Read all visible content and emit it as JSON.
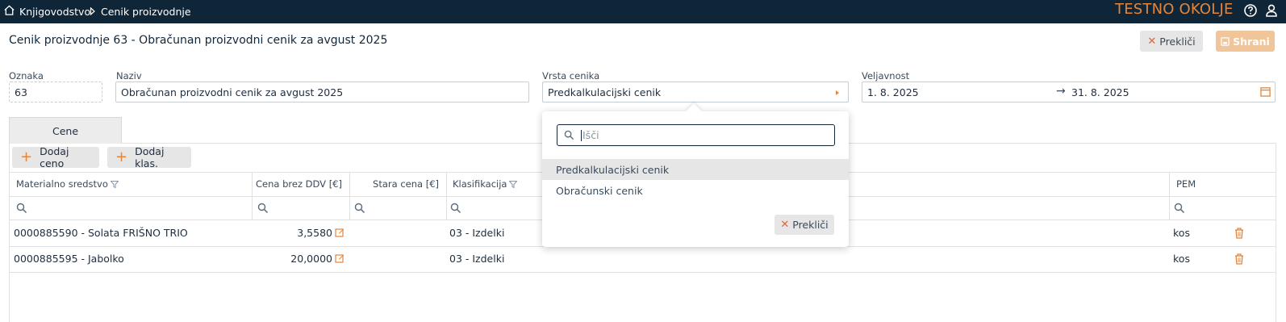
{
  "topbar": {
    "breadcrumb": [
      "Knjigovodstvo",
      "Cenik proizvodnje"
    ],
    "environment": "TESTNO OKOLJE"
  },
  "page": {
    "title": "Cenik proizvodnje 63 - Obračunan proizvodni cenik za avgust 2025",
    "cancel_label": "Prekliči",
    "save_label": "Shrani"
  },
  "form": {
    "oznaka_label": "Oznaka",
    "oznaka_value": "63",
    "naziv_label": "Naziv",
    "naziv_value": "Obračunan proizvodni cenik za avgust 2025",
    "vrsta_label": "Vrsta cenika",
    "vrsta_value": "Predkalkulacijski cenik",
    "veljavnost_label": "Veljavnost",
    "veljavnost_from": "1. 8. 2025",
    "veljavnost_to": "31. 8. 2025"
  },
  "tabs": [
    {
      "label": "Cene",
      "active": true
    }
  ],
  "toolbar": {
    "add_price_label": "Dodaj ceno",
    "add_class_label": "Dodaj klas."
  },
  "table": {
    "columns": [
      "Materialno sredstvo",
      "Cena brez DDV [€]",
      "Stara cena [€]",
      "Klasifikacija",
      "PEM"
    ],
    "rows": [
      {
        "material": "0000885590 - Solata FRIŠNO TRIO",
        "price": "3,5580",
        "old_price": "",
        "classification": "03 - Izdelki",
        "pem": "kos"
      },
      {
        "material": "0000885595 - Jabolko",
        "price": "20,0000",
        "old_price": "",
        "classification": "03 - Izdelki",
        "pem": "kos"
      }
    ]
  },
  "dropdown": {
    "search_placeholder": "Išči",
    "options": [
      "Predkalkulacijski cenik",
      "Obračunski cenik"
    ],
    "selected": "Predkalkulacijski cenik",
    "cancel_label": "Prekliči"
  },
  "colors": {
    "topbar_bg": "#0f2638",
    "accent": "#e5853a",
    "delete": "#e5853a"
  }
}
